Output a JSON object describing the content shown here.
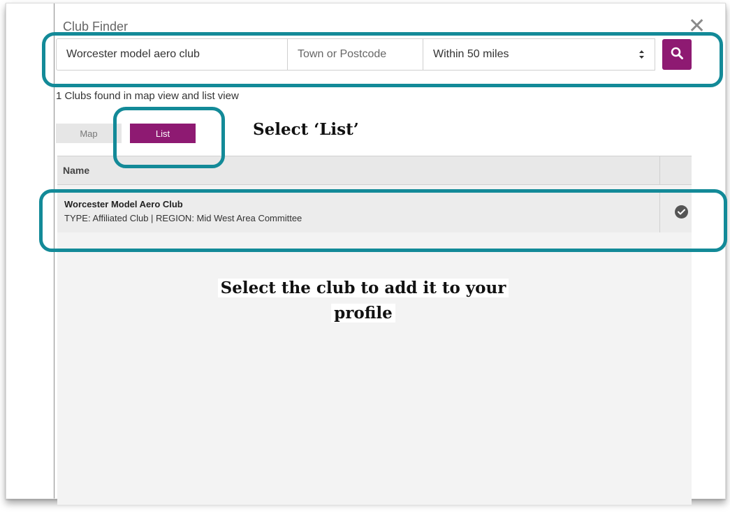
{
  "dialog": {
    "title": "Club Finder",
    "close_glyph": "✕"
  },
  "search": {
    "query_value": "Worcester model aero club",
    "town_placeholder": "Town or Postcode",
    "radius_selected": "Within 50 miles"
  },
  "results": {
    "count_text": "1 Clubs found in map view and list view"
  },
  "tabs": {
    "map_label": "Map",
    "list_label": "List"
  },
  "table": {
    "columns": [
      "Name",
      ""
    ],
    "rows": [
      {
        "name": "Worcester Model Aero Club",
        "meta": "TYPE: Affiliated Club | REGION: Mid West Area Committee",
        "selected": true
      }
    ]
  },
  "annotations": {
    "select_list": "Select ‘List’",
    "select_club_line1": "Select the club to add it to your",
    "select_club_line2": "profile"
  },
  "colors": {
    "brand_purple": "#8e1a72",
    "highlight_teal": "#138a98"
  },
  "icons": {
    "search_button": "search-icon",
    "close": "close-icon",
    "row_selected": "check-circle-icon",
    "select_arrows": "select-arrows-icon"
  }
}
